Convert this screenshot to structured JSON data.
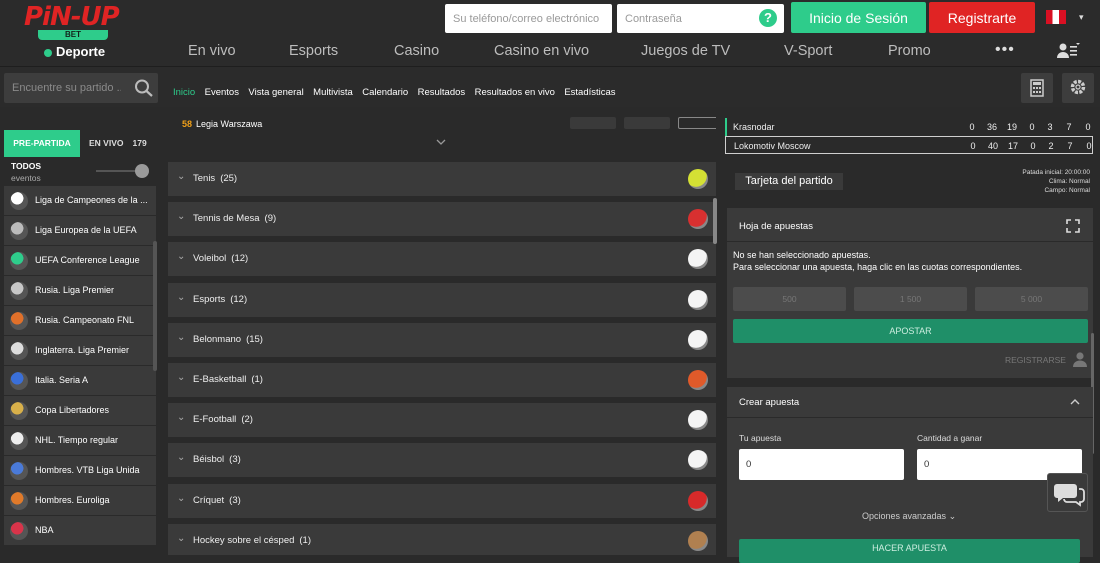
{
  "header": {
    "logo": {
      "brand": "PiN-UP",
      "badge": "BET",
      "section": "Deporte"
    },
    "phone_placeholder": "Su teléfono/correo electrónico",
    "password_placeholder": "Contraseña",
    "help_symbol": "?",
    "login_label": "Inicio de Sesión",
    "register_label": "Registrarte",
    "flag_caret": "▾",
    "colors": {
      "accent": "#2ecc8b",
      "brand_red": "#e02424",
      "panel": "#3a3a3a",
      "background": "#2a2a2a"
    }
  },
  "nav": {
    "items": [
      "En vivo",
      "Esports",
      "Casino",
      "Casino en vivo",
      "Juegos de TV",
      "V-Sport",
      "Promo"
    ],
    "more": "•••"
  },
  "subnav": {
    "search_placeholder": "Encuentre su partido ...",
    "tabs": [
      "Inicio",
      "Eventos",
      "Vista general",
      "Multivista",
      "Calendario",
      "Resultados",
      "Resultados en vivo",
      "Estadísticas"
    ],
    "active_tab": "Inicio",
    "tool_icons": [
      "calculator-icon",
      "gear-icon"
    ]
  },
  "sidebar": {
    "tab_prematch": "PRE-PARTIDA",
    "tab_live": "EN VIVO",
    "live_count": "179",
    "all_label": "TODOS",
    "all_sub": "eventos",
    "leagues": [
      {
        "label": "Liga de Campeones de la ...",
        "icon": "soccer-ball-icon",
        "color": "#ffffff"
      },
      {
        "label": "Liga Europea de la UEFA",
        "icon": "europa-trophy-icon",
        "color": "#bbbbbb"
      },
      {
        "label": "UEFA Conference League",
        "icon": "conference-trophy-icon",
        "color": "#2ecc8b"
      },
      {
        "label": "Rusia. Liga Premier",
        "icon": "rpl-logo-icon",
        "color": "#c8c8c8"
      },
      {
        "label": "Rusia. Campeonato FNL",
        "icon": "fnl-logo-icon",
        "color": "#e0702a"
      },
      {
        "label": "Inglaterra. Liga Premier",
        "icon": "lion-logo-icon",
        "color": "#dddddd"
      },
      {
        "label": "Italia. Seria A",
        "icon": "serie-a-logo-icon",
        "color": "#3a6fd8"
      },
      {
        "label": "Copa Libertadores",
        "icon": "libertadores-trophy-icon",
        "color": "#d8b04a"
      },
      {
        "label": "NHL. Tiempo regular",
        "icon": "nhl-shield-icon",
        "color": "#eeeeee"
      },
      {
        "label": "Hombres. VTB Liga Unida",
        "icon": "vtb-logo-icon",
        "color": "#4a7ad8"
      },
      {
        "label": "Hombres. Euroliga",
        "icon": "basketball-icon",
        "color": "#e07a2a"
      },
      {
        "label": "NBA",
        "icon": "nba-logo-icon",
        "color": "#d8344a"
      }
    ]
  },
  "center": {
    "partial_row": {
      "team": "Legia Warszawa",
      "number": "58"
    },
    "sports": [
      {
        "name": "Tenis",
        "count": "(25)",
        "icon": "tennis-ball-icon",
        "color": "#d4e034"
      },
      {
        "name": "Tennis de Mesa",
        "count": "(9)",
        "icon": "ping-pong-paddle-icon",
        "color": "#d83030"
      },
      {
        "name": "Voleibol",
        "count": "(12)",
        "icon": "volleyball-icon",
        "color": "#f4f4f4"
      },
      {
        "name": "Esports",
        "count": "(12)",
        "icon": "gamepad-icon",
        "color": "#f4f4f4"
      },
      {
        "name": "Belonmano",
        "count": "(15)",
        "icon": "handball-icon",
        "color": "#f4f4f4"
      },
      {
        "name": "E-Basketball",
        "count": "(1)",
        "icon": "e-basketball-icon",
        "color": "#e05a2a"
      },
      {
        "name": "E-Football",
        "count": "(2)",
        "icon": "e-football-icon",
        "color": "#f4f4f4"
      },
      {
        "name": "Béisbol",
        "count": "(3)",
        "icon": "baseball-icon",
        "color": "#f4f4f4"
      },
      {
        "name": "Críquet",
        "count": "(3)",
        "icon": "cricket-ball-icon",
        "color": "#d82a2a"
      },
      {
        "name": "Hockey sobre el césped",
        "count": "(1)",
        "icon": "field-hockey-icon",
        "color": "#b08050"
      }
    ]
  },
  "right": {
    "score": [
      {
        "team": "Krasnodar",
        "values": [
          "0",
          "36",
          "19",
          "0",
          "3",
          "7",
          "0"
        ]
      },
      {
        "team": "Lokomotiv Moscow",
        "values": [
          "0",
          "40",
          "17",
          "0",
          "2",
          "7",
          "0"
        ]
      }
    ],
    "match_card_label": "Tarjeta del partido",
    "meta": [
      "Patada inicial: 20:00:00",
      "Clima: Normal",
      "Campo: Normal"
    ],
    "betslip": {
      "title": "Hoja de apuestas",
      "empty_line1": "No se han seleccionado apuestas.",
      "empty_line2": "Para seleccionar una apuesta, haga clic en las cuotas correspondientes.",
      "amounts": [
        "500",
        "1 500",
        "5 000"
      ],
      "place_label": "APOSTAR",
      "register_label": "REGISTRARSE"
    },
    "create_bet": {
      "title": "Crear apuesta",
      "stake_label": "Tu apuesta",
      "stake_value": "0",
      "win_label": "Cantidad a ganar",
      "win_value": "0",
      "advanced": "Opciones avanzadas",
      "button": "HACER APUESTA"
    }
  }
}
